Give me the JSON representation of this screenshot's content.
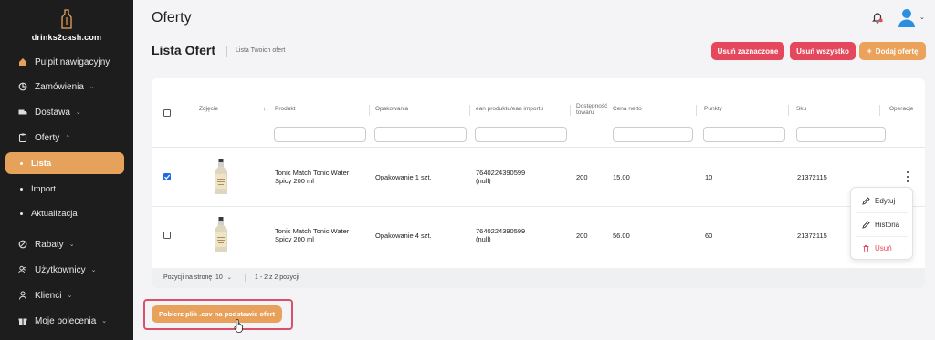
{
  "brand": {
    "name": "drinks2cash.com"
  },
  "sidebar": {
    "items": [
      {
        "label": "Pulpit nawigacyjny",
        "icon": "home-icon"
      },
      {
        "label": "Zamówienia",
        "icon": "cart-icon"
      },
      {
        "label": "Dostawa",
        "icon": "truck-icon"
      },
      {
        "label": "Oferty",
        "icon": "clipboard-icon"
      }
    ],
    "sub_items": [
      {
        "label": "Lista",
        "active": true
      },
      {
        "label": "Import"
      },
      {
        "label": "Aktualizacja"
      }
    ],
    "bottom_items": [
      {
        "label": "Rabaty",
        "icon": "discount-icon"
      },
      {
        "label": "Użytkownicy",
        "icon": "users-icon"
      },
      {
        "label": "Klienci",
        "icon": "person-icon"
      },
      {
        "label": "Moje polecenia",
        "icon": "gift-icon"
      }
    ]
  },
  "header": {
    "title": "Oferty"
  },
  "page": {
    "title": "Lista Ofert",
    "caption": "Lista Twoich ofert"
  },
  "actions": {
    "delete_selected": "Usuń zaznaczone",
    "delete_all": "Usuń wszystko",
    "add_offer": "Dodaj ofertę"
  },
  "table": {
    "columns": [
      "Zdjęcie",
      "Produkt",
      "Opakowania",
      "ean produktu/ean importu",
      "Dostępność towaru",
      "Cena netto",
      "Punkty",
      "Sku",
      "Operacje"
    ],
    "rows": [
      {
        "checked": true,
        "product_line1": "Tonic Match Tonic Water",
        "product_line2": "Spicy 200 ml",
        "packaging": "Opakowanie 1 szt.",
        "ean_line1": "7640224390599",
        "ean_line2": "(null)",
        "stock": "200",
        "price": "15.00",
        "points": "10",
        "sku": "21372115"
      },
      {
        "checked": false,
        "product_line1": "Tonic Match Tonic Water",
        "product_line2": "Spicy 200 ml",
        "packaging": "Opakowanie 4 szt.",
        "ean_line1": "7640224390599",
        "ean_line2": "(null)",
        "stock": "200",
        "price": "56.00",
        "points": "60",
        "sku": "21372115"
      }
    ],
    "footer": {
      "per_page_label": "Pozycji na stronę",
      "per_page_value": "10",
      "range": "1 - 2 z 2 pozycji"
    }
  },
  "row_menu": {
    "edit": "Edytuj",
    "history": "Historia",
    "delete": "Usuń"
  },
  "export_button": "Pobierz plik .csv na podstawie ofert",
  "colors": {
    "accent": "#e6a15a",
    "danger": "#e5485c",
    "sidebar_bg": "#1d1d1d",
    "checkbox": "#1e6be0"
  }
}
